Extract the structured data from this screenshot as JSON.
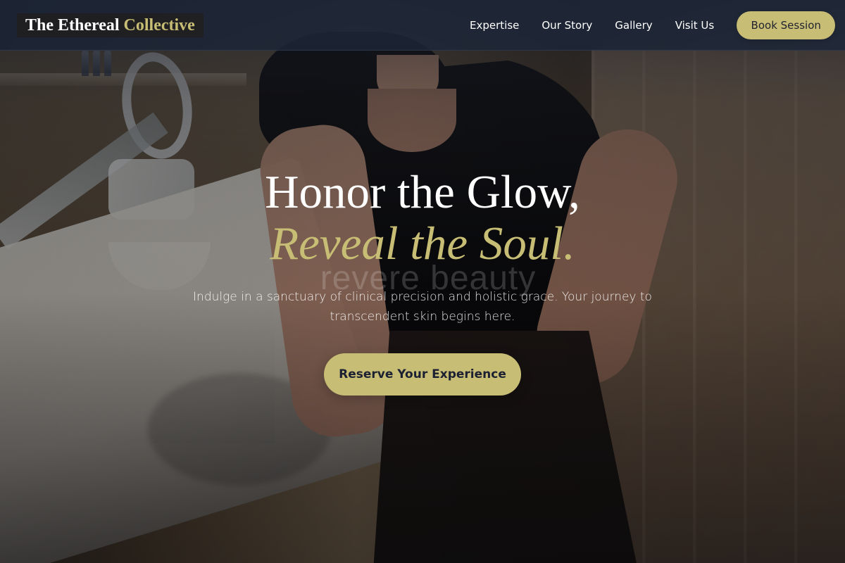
{
  "header": {
    "brand": {
      "main": "The Ethereal",
      "accent": "Collective"
    },
    "nav": [
      {
        "label": "Expertise"
      },
      {
        "label": "Our Story"
      },
      {
        "label": "Gallery"
      },
      {
        "label": "Visit Us"
      }
    ],
    "cta_label": "Book Session"
  },
  "hero": {
    "headline": "Honor the Glow,",
    "accent_headline": "Reveal the Soul.",
    "ghost_text": "revere beauty",
    "description": "Indulge in a sanctuary of clinical precision and holistic grace. Your journey to transcendent skin begins here.",
    "button_label": "Reserve Your Experience"
  },
  "colors": {
    "header_background": "#1D2638",
    "accent_gold": "#C8BD74",
    "dark_text": "#1F2230",
    "white": "#FFFFFF"
  }
}
